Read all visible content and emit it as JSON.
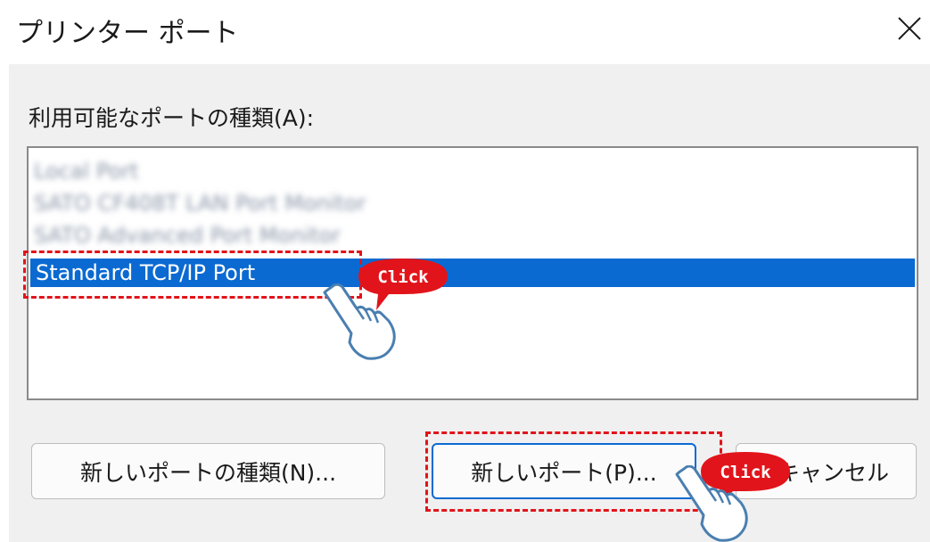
{
  "dialog": {
    "title": "プリンター ポート",
    "close_glyph": "✕"
  },
  "ports": {
    "label": "利用可能なポートの種類(A):",
    "items": [
      {
        "label": "Local Port",
        "selected": false,
        "obscured": true
      },
      {
        "label": "SATO CF408T LAN Port Monitor",
        "selected": false,
        "obscured": true
      },
      {
        "label": "SATO Advanced Port Monitor",
        "selected": false,
        "obscured": true
      },
      {
        "label": "Standard TCP/IP Port",
        "selected": true,
        "obscured": false
      }
    ]
  },
  "buttons": {
    "new_port_type": "新しいポートの種類(N)...",
    "new_port": "新しいポート(P)...",
    "cancel": "キャンセル"
  },
  "annotations": {
    "click_label_1": "Click",
    "click_label_2": "Click",
    "highlight_color": "#e2141b"
  },
  "colors": {
    "selection": "#0b6ad1",
    "dialog_background": "#f0f0f0"
  }
}
